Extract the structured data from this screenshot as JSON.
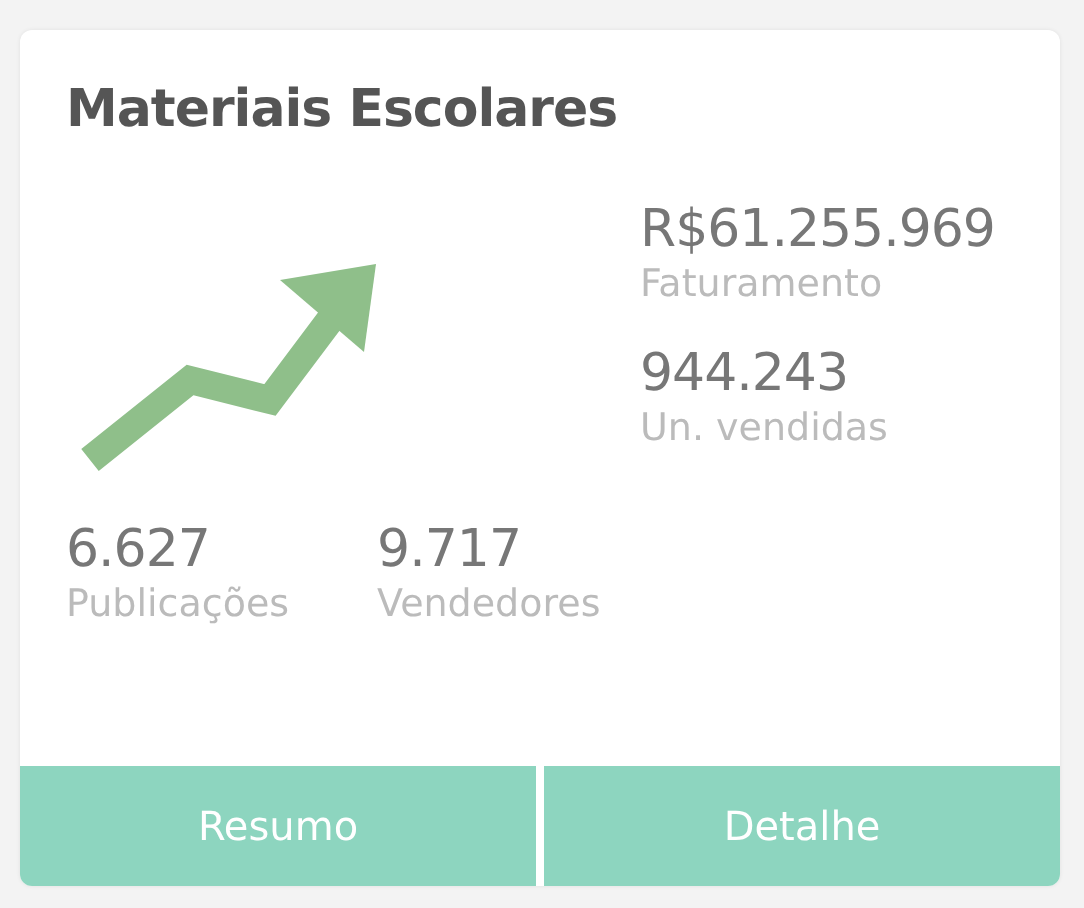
{
  "card": {
    "title": "Materiais Escolares",
    "main_stats": [
      {
        "value": "R$61.255.969",
        "label": "Faturamento"
      },
      {
        "value": "944.243",
        "label": "Un. vendidas"
      }
    ],
    "bottom_stats": [
      {
        "value": "6.627",
        "label": "Publicações"
      },
      {
        "value": "9.717",
        "label": "Vendedores"
      }
    ],
    "buttons": [
      "Resumo",
      "Detalhe"
    ]
  }
}
